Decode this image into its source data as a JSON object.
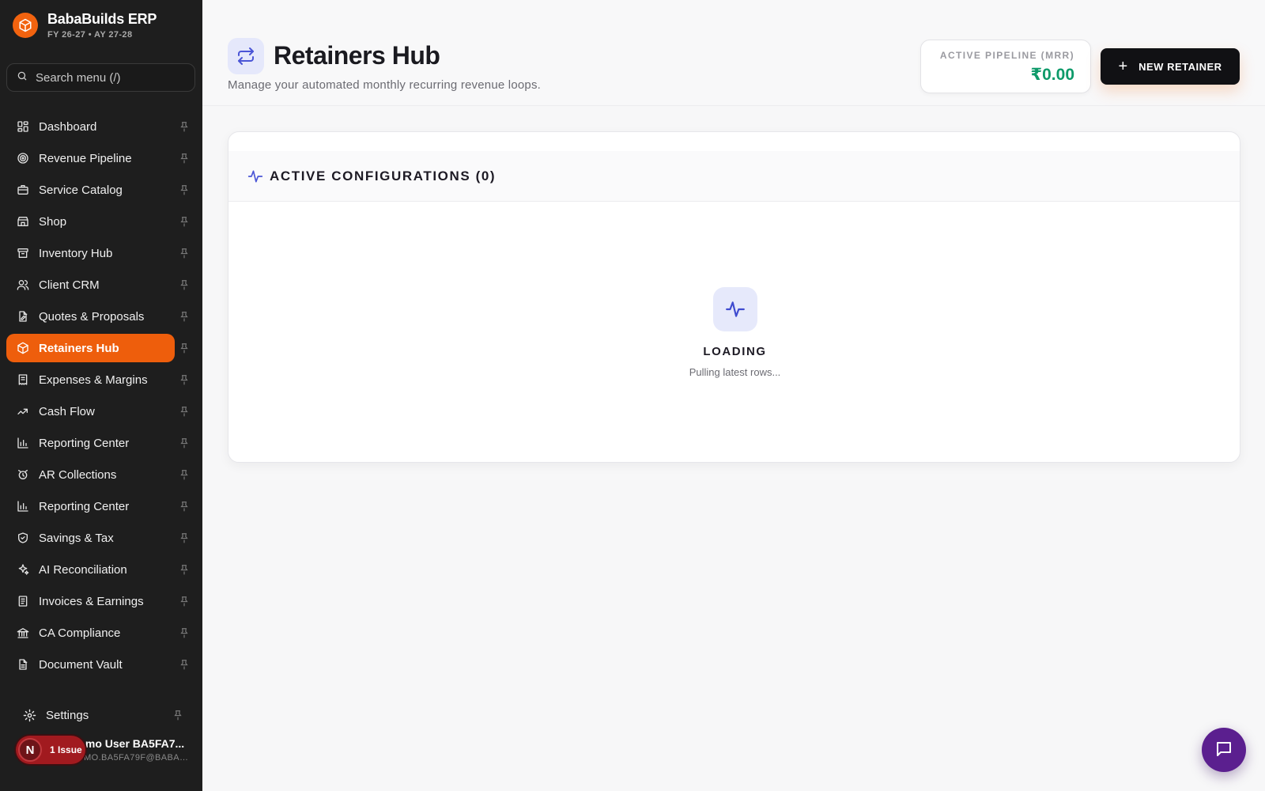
{
  "brand": {
    "title": "BabaBuilds ERP",
    "subtitle": "FY 26-27 • AY 27-28",
    "logo_icon": "cube-icon",
    "accent": "#f2630f"
  },
  "search": {
    "placeholder": "Search menu (/)"
  },
  "sidebar": {
    "items": [
      {
        "label": "Dashboard",
        "icon": "dashboard-icon",
        "active": false
      },
      {
        "label": "Revenue Pipeline",
        "icon": "target-icon",
        "active": false
      },
      {
        "label": "Service Catalog",
        "icon": "briefcase-icon",
        "active": false
      },
      {
        "label": "Shop",
        "icon": "store-icon",
        "active": false
      },
      {
        "label": "Inventory Hub",
        "icon": "archive-icon",
        "active": false
      },
      {
        "label": "Client CRM",
        "icon": "users-icon",
        "active": false
      },
      {
        "label": "Quotes & Proposals",
        "icon": "file-edit-icon",
        "active": false
      },
      {
        "label": "Retainers Hub",
        "icon": "cube-icon",
        "active": true
      },
      {
        "label": "Expenses & Margins",
        "icon": "receipt-icon",
        "active": false
      },
      {
        "label": "Cash Flow",
        "icon": "cash-flow-icon",
        "active": false
      },
      {
        "label": "Reporting Center",
        "icon": "bar-chart-icon",
        "active": false
      },
      {
        "label": "AR Collections",
        "icon": "alarm-icon",
        "active": false
      },
      {
        "label": "Reporting Center",
        "icon": "bar-chart-icon",
        "active": false
      },
      {
        "label": "Savings & Tax",
        "icon": "shield-icon",
        "active": false
      },
      {
        "label": "AI Reconciliation",
        "icon": "sparkles-icon",
        "active": false
      },
      {
        "label": "Invoices & Earnings",
        "icon": "invoice-icon",
        "active": false
      },
      {
        "label": "CA Compliance",
        "icon": "landmark-icon",
        "active": false
      },
      {
        "label": "Document Vault",
        "icon": "document-icon",
        "active": false
      }
    ],
    "settings_label": "Settings",
    "active_color": "#ee5e0c"
  },
  "user": {
    "name": "Demo User BA5FA7...",
    "email": "DEMO.BA5FA79F@BABAB...",
    "avatar_letter": "N",
    "issue_label": "1 Issue",
    "issue_color": "#a11a1f"
  },
  "page": {
    "title": "Retainers Hub",
    "subtitle": "Manage your automated monthly recurring revenue loops.",
    "icon": "repeat-icon"
  },
  "mrr": {
    "label": "ACTIVE PIPELINE (MRR)",
    "value": "₹0.00",
    "value_color": "#0e9a6a"
  },
  "new_button": {
    "label": "NEW RETAINER",
    "icon": "plus-icon"
  },
  "panel": {
    "title": "ACTIVE CONFIGURATIONS (0)",
    "icon": "activity-icon"
  },
  "loading": {
    "title": "LOADING",
    "subtitle": "Pulling latest rows..."
  },
  "chat": {
    "icon": "chat-icon",
    "color": "#5b1f8f"
  }
}
